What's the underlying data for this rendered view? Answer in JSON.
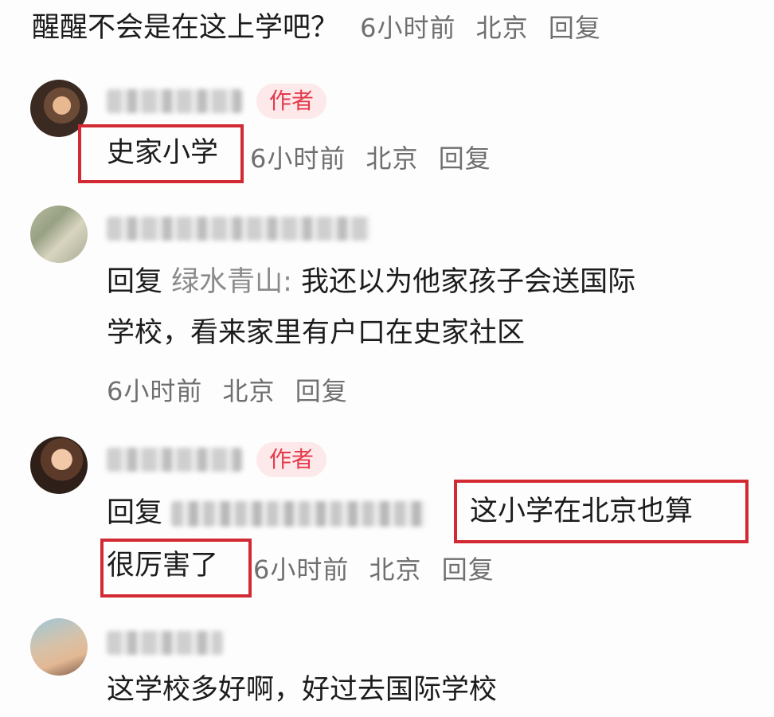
{
  "top_comment": {
    "text": "醒醒不会是在这上学吧？",
    "time": "6小时前",
    "location": "北京",
    "reply": "回复"
  },
  "comments": [
    {
      "badge": "作者",
      "text": "史家小学",
      "time": "6小时前",
      "location": "北京",
      "reply": "回复"
    },
    {
      "reply_prefix": "回复",
      "reply_to": "绿水青山:",
      "text_line1": "我还以为他家孩子会送国际",
      "text_line2": "学校，看来家里有户口在史家社区",
      "time": "6小时前",
      "location": "北京",
      "reply": "回复"
    },
    {
      "badge": "作者",
      "reply_prefix": "回复",
      "text_line1": "这小学在北京也算",
      "text_line2": "很厉害了",
      "time": "6小时前",
      "location": "北京",
      "reply": "回复"
    },
    {
      "text": "这学校多好啊，好过去国际学校"
    }
  ],
  "colors": {
    "badge_text": "#e53a4a",
    "badge_bg": "#fde8ea",
    "highlight_box": "#d12a33",
    "meta_text": "#6f6f6f"
  }
}
